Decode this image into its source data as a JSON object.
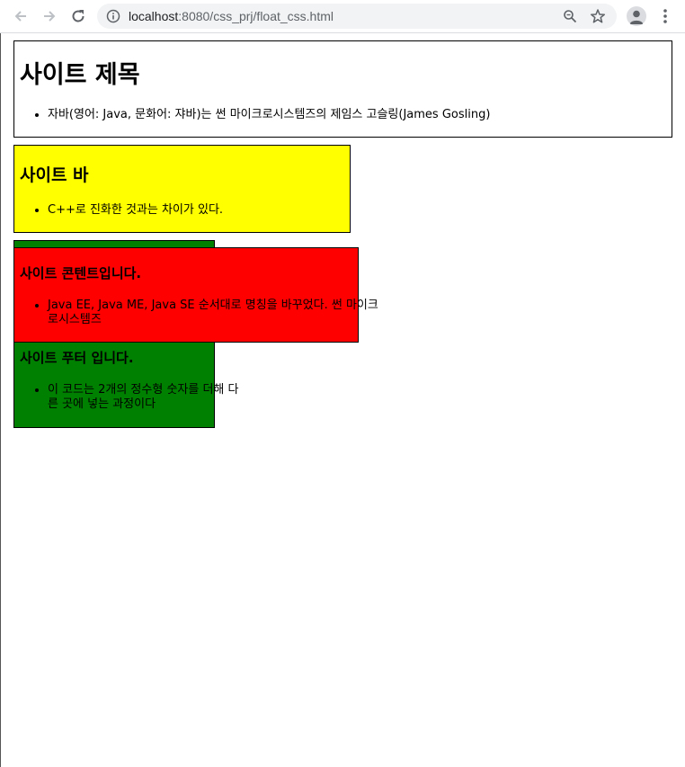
{
  "browser": {
    "url_host": "localhost",
    "url_path": ":8080/css_prj/float_css.html",
    "icons": [
      "back-icon",
      "forward-icon",
      "reload-icon",
      "info-icon",
      "zoom-icon",
      "star-icon",
      "avatar-icon",
      "menu-icon"
    ]
  },
  "header": {
    "title": "사이트 제목",
    "items": [
      "자바(영어: Java, 문화어: 쟈바)는 썬 마이크로시스템즈의 제임스 고슬링(James Gosling)"
    ],
    "bg": "#ffffff"
  },
  "nav": {
    "title": "사이트 바",
    "items": [
      "C++로 진화한 것과는 차이가 있다."
    ],
    "bg": "#ffff00"
  },
  "content": {
    "title": "사이트 콘텐트입니다.",
    "items": [
      "Java EE, Java ME, Java SE 순서대로 명칭을 바꾸었다. 썬 마이크로시스템즈"
    ],
    "bg": "#ff0000"
  },
  "footer": {
    "title": "사이트 푸터 입니다.",
    "items": [
      "이 코드는 2개의 정수형 숫자를 더해 다른 곳에 넣는 과정이다"
    ],
    "bg": "#008000"
  }
}
